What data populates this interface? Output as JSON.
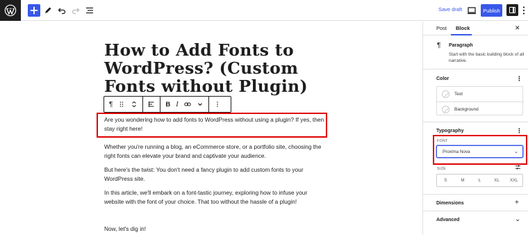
{
  "topbar": {
    "logo": "wordpress-logo",
    "icons": [
      "add-block-icon",
      "pencil-icon",
      "undo-icon",
      "redo-icon",
      "list-view-icon"
    ],
    "save_draft": "Save draft",
    "publish": "Publish"
  },
  "editor": {
    "title": "How to Add Fonts to WordPress? (Custom Fonts without Plugin)",
    "block_toolbar": {
      "paragraph_glyph": "¶",
      "bold": "B",
      "italic": "I"
    },
    "paragraphs": [
      "Are you wondering how to add fonts to WordPress without using a plugin? If yes, then stay right here!",
      "Whether you're running a blog, an eCommerce store, or a portfolio site, choosing the right fonts can elevate your brand and captivate your audience.",
      "But here's the twist: You don't need a fancy plugin to add custom fonts to your WordPress site.",
      "In this article, we'll embark on a font-tastic journey, exploring how to infuse your website with the font of your choice. That too without the hassle of a plugin!",
      "Now, let's dig in!"
    ]
  },
  "sidebar": {
    "tabs": [
      "Post",
      "Block"
    ],
    "active_tab": "Block",
    "close": "✕",
    "block_card": {
      "icon": "¶",
      "name": "Paragraph",
      "description": "Start with the basic building block of all narrative."
    },
    "color": {
      "heading": "Color",
      "items": [
        "Text",
        "Background"
      ]
    },
    "typography": {
      "heading": "Typography",
      "font_label": "FONT",
      "font_value": "Proxima Nova",
      "size_label": "SIZE",
      "sizes": [
        "S",
        "M",
        "L",
        "XL",
        "XXL"
      ]
    },
    "panels": [
      {
        "label": "Dimensions",
        "icon": "+"
      },
      {
        "label": "Advanced",
        "icon": "⌄"
      }
    ]
  },
  "colors": {
    "accent": "#3858e9",
    "highlight": "#e00000",
    "dark": "#1e1e1e"
  }
}
